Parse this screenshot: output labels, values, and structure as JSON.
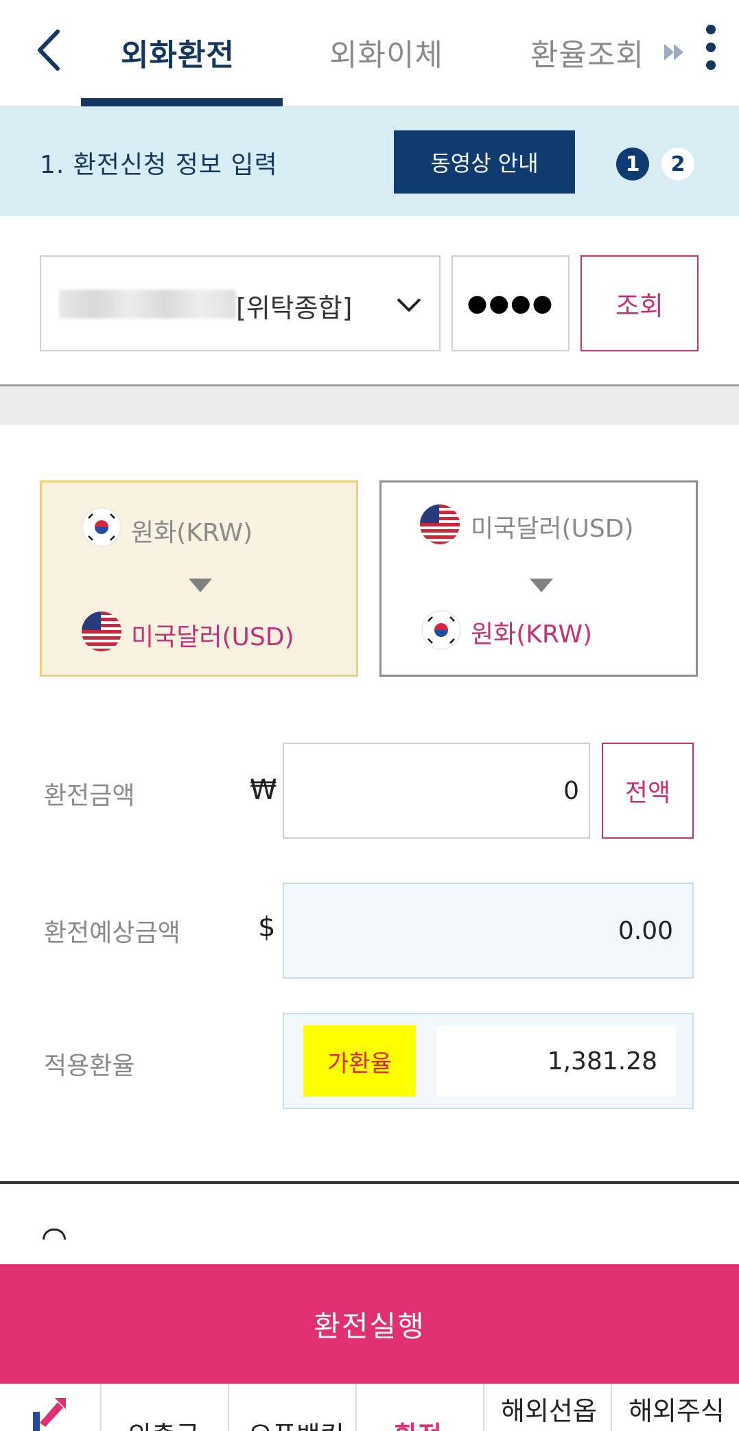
{
  "tabs": [
    {
      "label": "외화환전",
      "active": true
    },
    {
      "label": "외화이체",
      "active": false
    },
    {
      "label": "환율조회",
      "active": false
    }
  ],
  "step": {
    "title": "1. 환전신청 정보 입력",
    "video_button": "동영상 안내",
    "indicators": [
      "1",
      "2"
    ],
    "current": 1
  },
  "account": {
    "type_label": "[위탁종합]",
    "password_mask": "●●●●",
    "search_button": "조회"
  },
  "directions": [
    {
      "from": "원화(KRW)",
      "to": "미국달러(USD)",
      "selected": true
    },
    {
      "from": "미국달러(USD)",
      "to": "원화(KRW)",
      "selected": false
    }
  ],
  "form": {
    "amount_label": "환전금액",
    "amount_symbol": "₩",
    "amount_value": "0",
    "all_button": "전액",
    "expected_label": "환전예상금액",
    "expected_symbol": "$",
    "expected_value": "0.00",
    "rate_label": "적용환율",
    "rate_badge": "가환율",
    "rate_value": "1,381.28"
  },
  "execute_button": "환전실행",
  "bottom_nav": [
    "외출금",
    "오픈뱅킹",
    "환전",
    "해외선옵",
    "해외주식"
  ],
  "colors": {
    "navy": "#15365e",
    "accent_pink": "#e12f73",
    "label_pink": "#c2317a",
    "step_bg": "#d8ecf4"
  }
}
